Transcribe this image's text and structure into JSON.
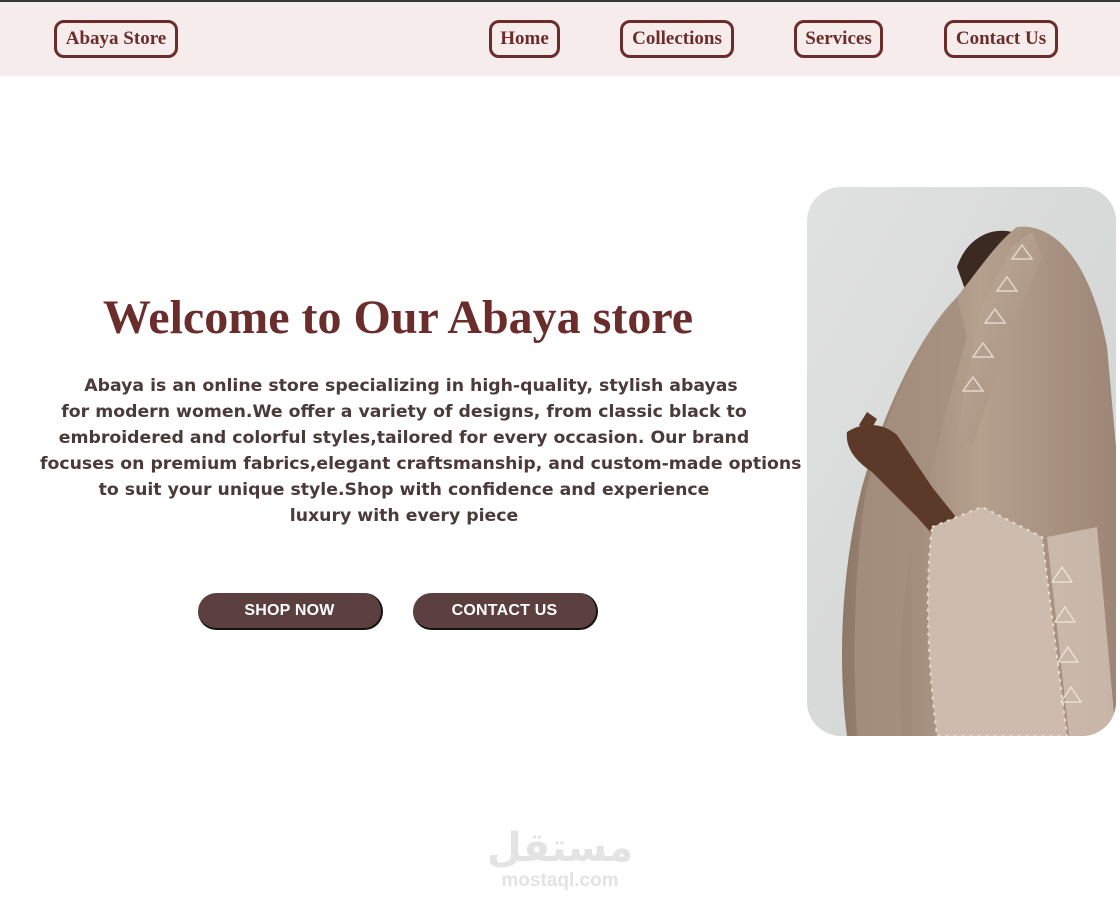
{
  "nav": {
    "brand": "Abaya Store",
    "links": [
      "Home",
      "Collections",
      "Services",
      "Contact Us"
    ]
  },
  "hero": {
    "title": "Welcome to Our Abaya store",
    "description_lines": [
      "Abaya is an online store specializing in high-quality, stylish abayas",
      "for modern women.We offer a variety of designs, from classic black to",
      "embroidered and colorful styles,tailored for every occasion. Our brand",
      "focuses on premium fabrics,elegant craftsmanship, and custom-made options",
      "to suit your unique style.Shop with confidence and experience",
      "luxury with every piece"
    ],
    "primary_button": "SHOP NOW",
    "secondary_button": "CONTACT US"
  },
  "watermark": {
    "arabic": "مستقل",
    "latin": "mostaql.com"
  },
  "colors": {
    "brand": "#6b2c2c",
    "nav_bg": "#f6ecec",
    "button_bg": "#5c3f3f",
    "text": "#4a3a3a"
  }
}
